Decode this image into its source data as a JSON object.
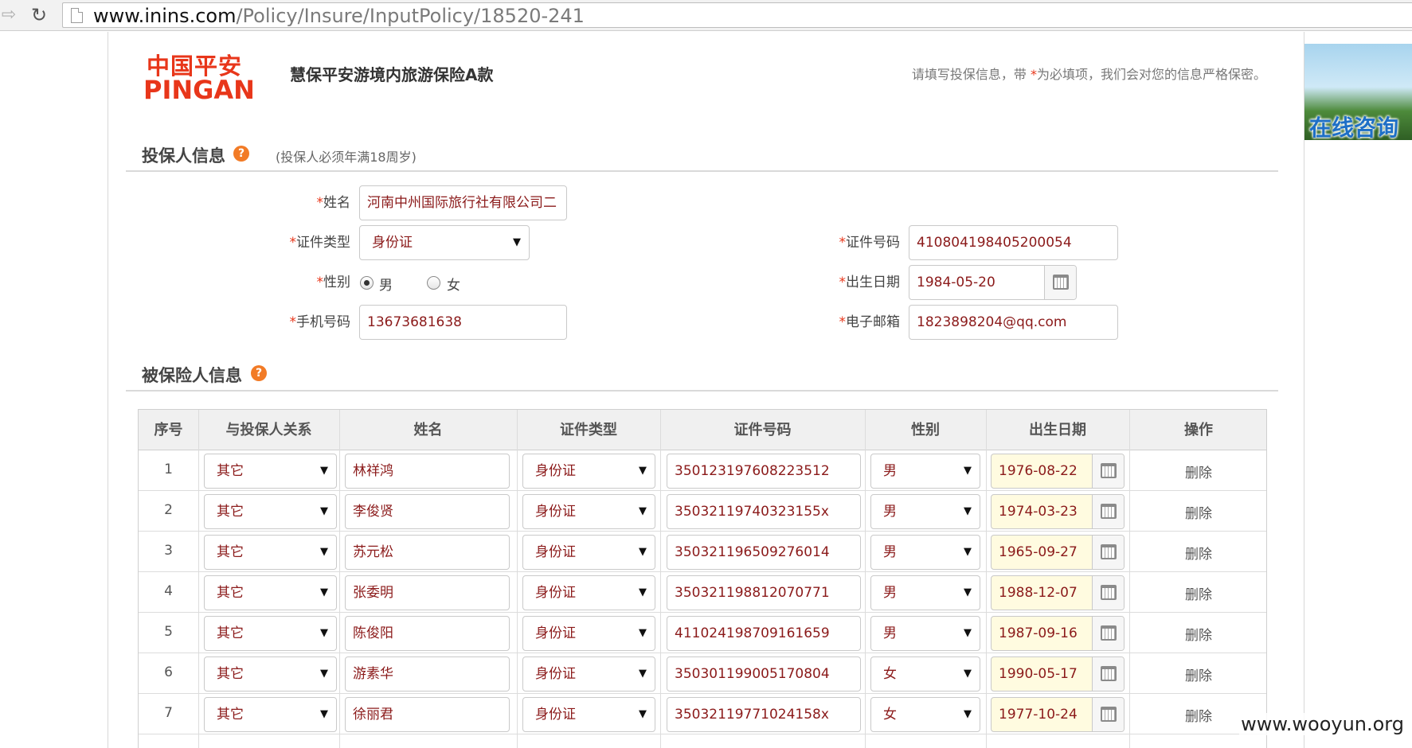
{
  "browser": {
    "url_host": "www.inins.com",
    "url_path": "/Policy/Insure/InputPolicy/18520-241"
  },
  "header": {
    "logo_cn": "中国平安",
    "logo_en": "PINGAN",
    "product_title": "慧保平安游境内旅游保险A款",
    "notice_before": "请填写投保信息，带 ",
    "notice_star": "*",
    "notice_after": "为必填项，我们会对您的信息严格保密。"
  },
  "consult": {
    "label": "在线咨询"
  },
  "applicant": {
    "title": "投保人信息",
    "help": "?",
    "note": "(投保人必须年满18周岁)",
    "star": "*",
    "name_label": "姓名",
    "name_value": "河南中州国际旅行社有限公司二",
    "id_type_label": "证件类型",
    "id_type_value": "身份证",
    "id_number_label": "证件号码",
    "id_number_value": "410804198405200054",
    "gender_label": "性别",
    "gender_male": "男",
    "gender_female": "女",
    "birth_label": "出生日期",
    "birth_value": "1984-05-20",
    "phone_label": "手机号码",
    "phone_value": "13673681638",
    "email_label": "电子邮箱",
    "email_value": "1823898204@qq.com"
  },
  "insured": {
    "title": "被保险人信息",
    "help": "?",
    "columns": [
      "序号",
      "与投保人关系",
      "姓名",
      "证件类型",
      "证件号码",
      "性别",
      "出生日期",
      "操作"
    ],
    "delete_label": "删除",
    "rows": [
      {
        "no": "1",
        "relation": "其它",
        "name": "林祥鸿",
        "id_type": "身份证",
        "id_number": "350123197608223512",
        "gender": "男",
        "birth": "1976-08-22"
      },
      {
        "no": "2",
        "relation": "其它",
        "name": "李俊贤",
        "id_type": "身份证",
        "id_number": "35032119740323155x",
        "gender": "男",
        "birth": "1974-03-23"
      },
      {
        "no": "3",
        "relation": "其它",
        "name": "苏元松",
        "id_type": "身份证",
        "id_number": "350321196509276014",
        "gender": "男",
        "birth": "1965-09-27"
      },
      {
        "no": "4",
        "relation": "其它",
        "name": "张委明",
        "id_type": "身份证",
        "id_number": "350321198812070771",
        "gender": "男",
        "birth": "1988-12-07"
      },
      {
        "no": "5",
        "relation": "其它",
        "name": "陈俊阳",
        "id_type": "身份证",
        "id_number": "411024198709161659",
        "gender": "男",
        "birth": "1987-09-16"
      },
      {
        "no": "6",
        "relation": "其它",
        "name": "游素华",
        "id_type": "身份证",
        "id_number": "350301199005170804",
        "gender": "女",
        "birth": "1990-05-17"
      },
      {
        "no": "7",
        "relation": "其它",
        "name": "徐丽君",
        "id_type": "身份证",
        "id_number": "35032119771024158x",
        "gender": "女",
        "birth": "1977-10-24"
      }
    ]
  },
  "watermark": "www.wooyun.org",
  "colors": {
    "brand": "#e8361a",
    "help": "#f27b26",
    "value_text": "#8b1a1a",
    "date_bg": "#fffbe0"
  },
  "icons": [
    "back-arrow-icon",
    "reload-icon",
    "page-icon",
    "help-icon",
    "dropdown-arrow-icon",
    "calendar-icon"
  ]
}
